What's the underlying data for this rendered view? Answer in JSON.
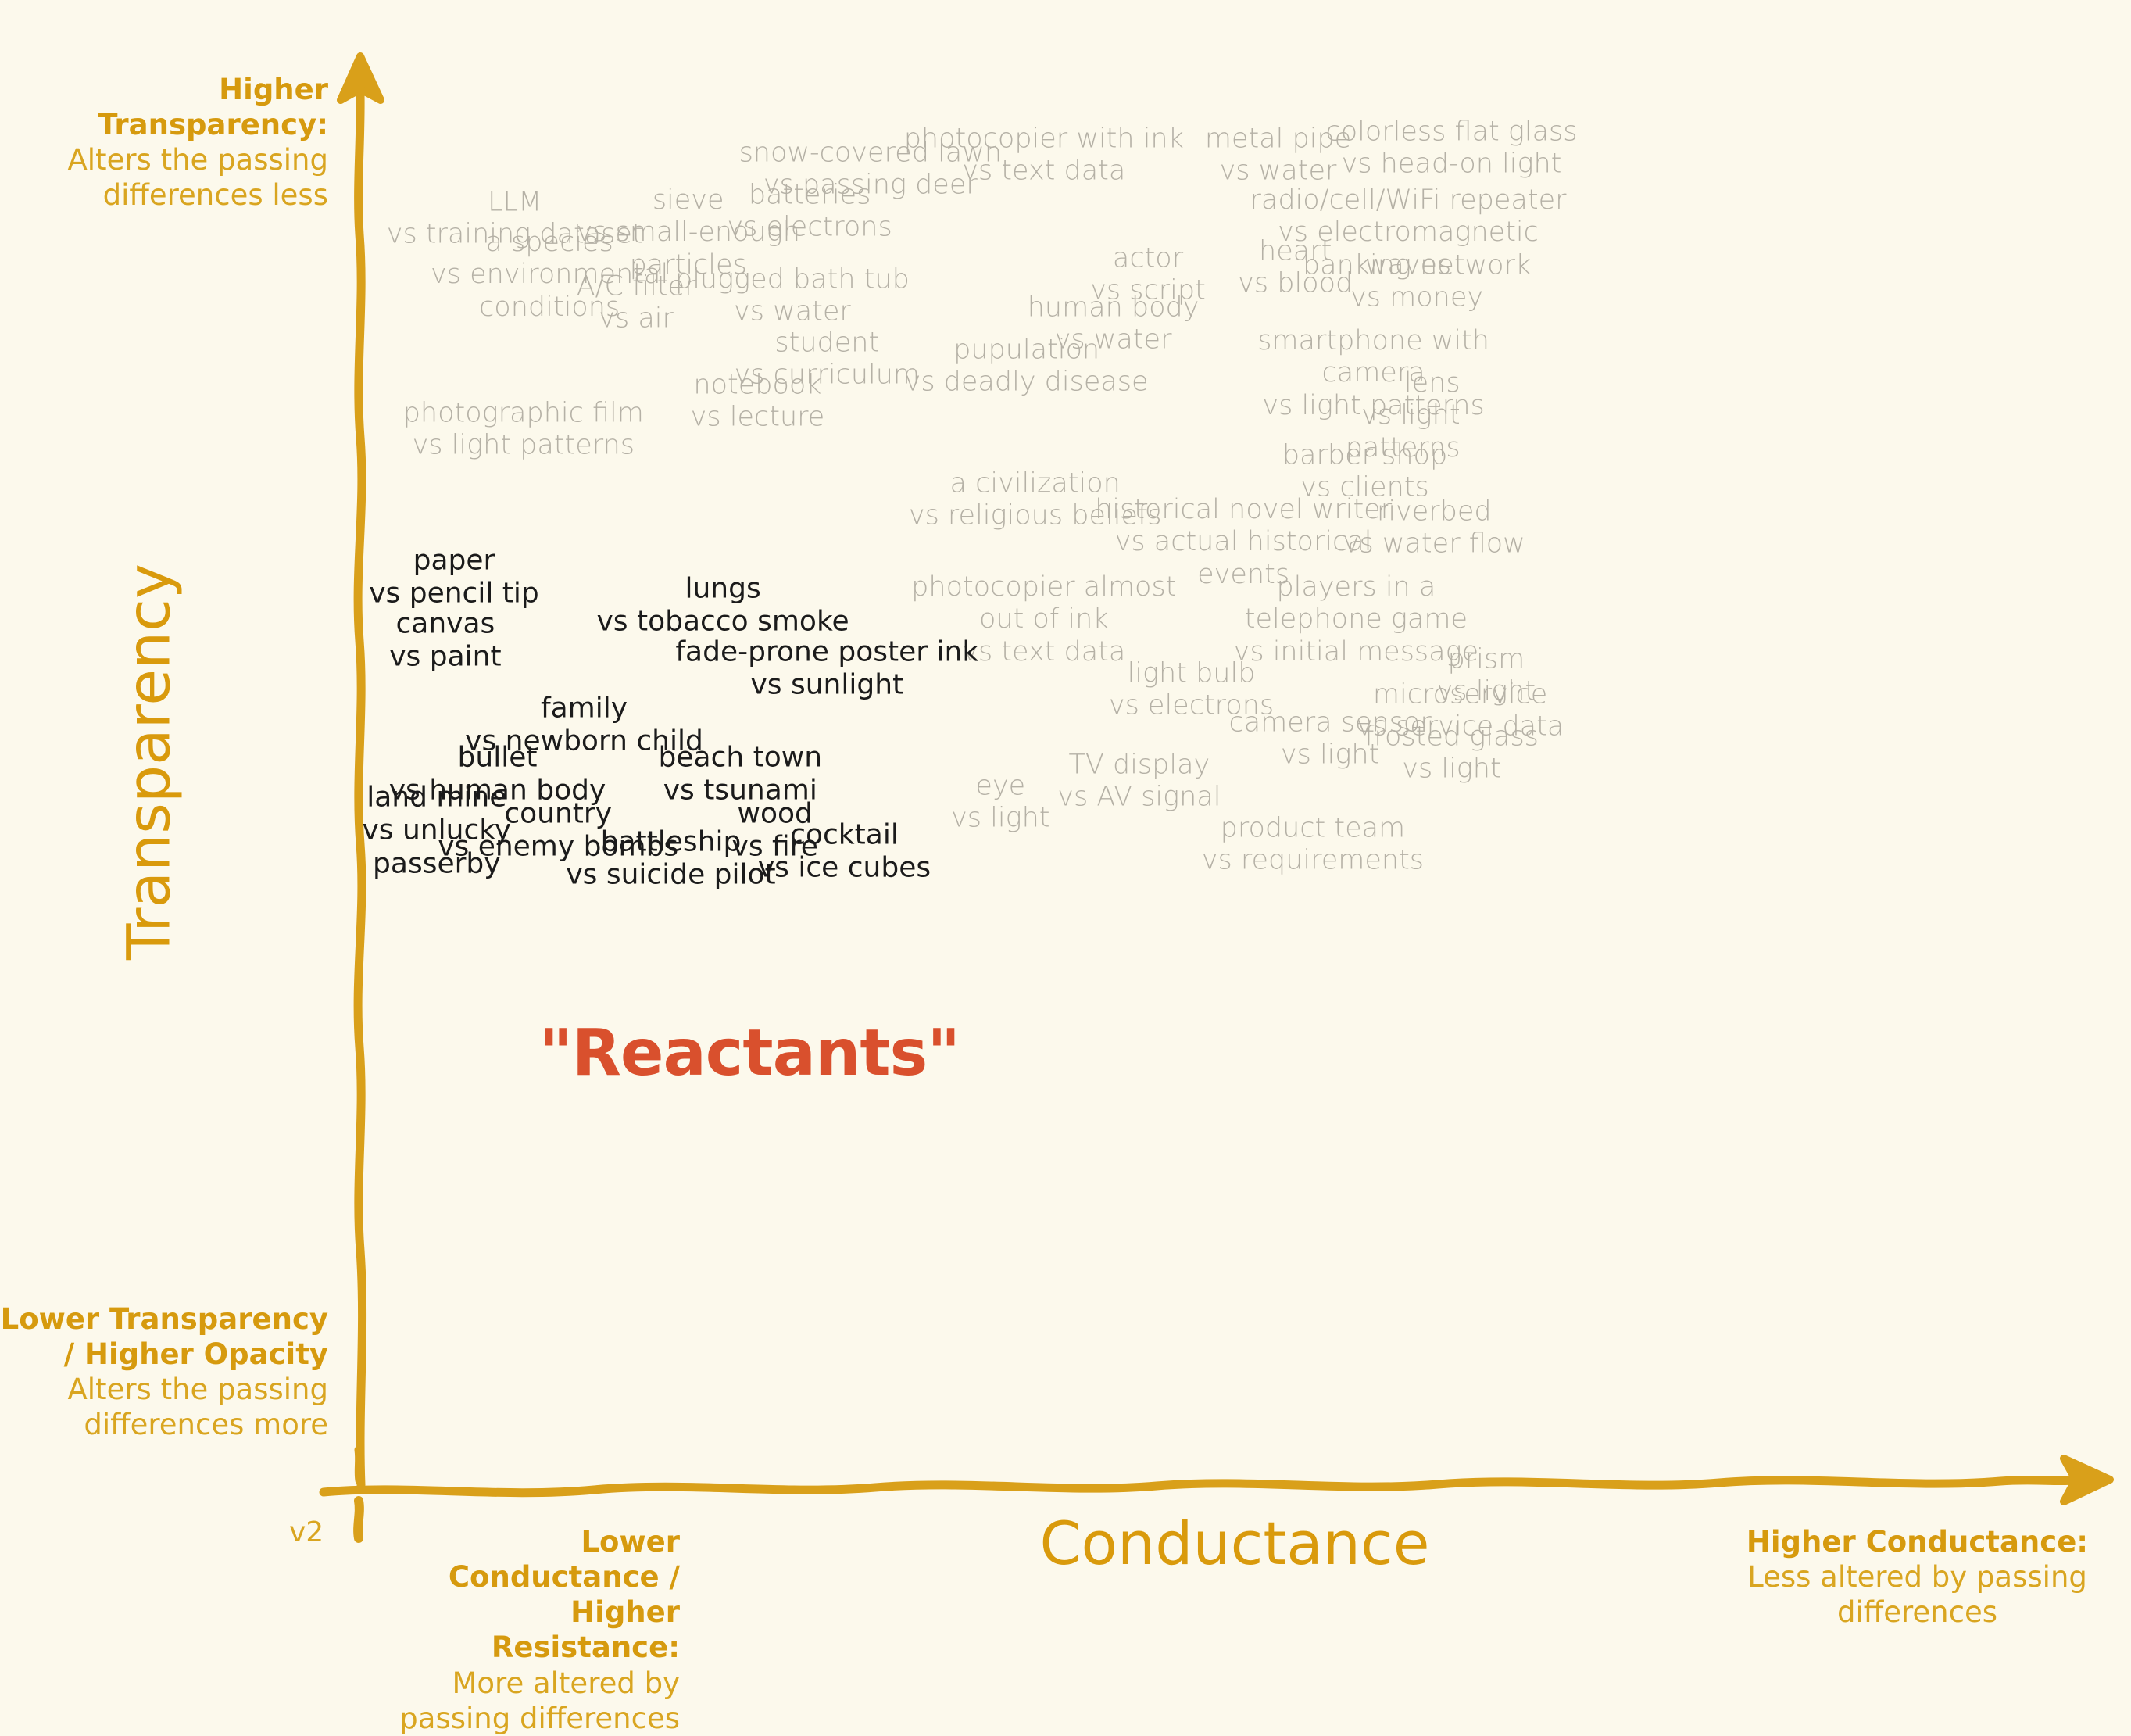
{
  "meta": {
    "version_label": "v2",
    "background_color": "#fcf9ec",
    "accent_gold": "#D9A01A",
    "accent_red": "#D9502D",
    "light_label_color": "#b5b1a6",
    "dark_label_color": "#1b1b1b"
  },
  "axes": {
    "y_title": "Transparency",
    "x_title": "Conductance",
    "y_top": {
      "bold": "Higher Transparency:",
      "normal": "Alters the passing\ndifferences less"
    },
    "y_bottom": {
      "bold": "Lower Transparency\n/ Higher Opacity",
      "normal": "Alters the passing\ndifferences more"
    },
    "x_left": {
      "bold": "Lower Conductance\n/ Higher Resistance:",
      "normal": "More altered by\npassing differences"
    },
    "x_right": {
      "bold": "Higher Conductance:",
      "normal": "Less altered by passing\ndifferences"
    }
  },
  "center_annotation": "\"Reactants\"",
  "chart_data": {
    "type": "scatter",
    "title": "",
    "xlabel": "Conductance",
    "ylabel": "Transparency",
    "xlim": [
      0,
      100
    ],
    "ylim": [
      0,
      100
    ],
    "grid": false,
    "legend": null,
    "note": "Text-label scatter. x = conductance (left low, right high), y = transparency (bottom low, top high). Values estimated from pixel position. 'tone' light = faint gray label, dark = black label.",
    "points": [
      {
        "label": "snow-covered lawn\nvs passing deer",
        "x": 29.0,
        "y": 93.5,
        "tone": "light",
        "align": "center"
      },
      {
        "label": "photocopier with ink\nvs text data",
        "x": 39.0,
        "y": 94.5,
        "tone": "light",
        "align": "center"
      },
      {
        "label": "metal pipe\nvs water",
        "x": 52.5,
        "y": 94.5,
        "tone": "light",
        "align": "center"
      },
      {
        "label": "colorless flat glass\nvs head-on light",
        "x": 62.5,
        "y": 95.0,
        "tone": "light",
        "align": "center"
      },
      {
        "label": "LLM\nvs training dataset",
        "x": 8.5,
        "y": 90.0,
        "tone": "light",
        "align": "center"
      },
      {
        "label": "sieve\nvs small-enough\nparticles",
        "x": 18.5,
        "y": 89.0,
        "tone": "light",
        "align": "center"
      },
      {
        "label": "batteries\nvs electrons",
        "x": 25.5,
        "y": 90.5,
        "tone": "light",
        "align": "center"
      },
      {
        "label": "radio/cell/WiFi repeater\nvs electromagnetic\nwaves",
        "x": 60.0,
        "y": 89.0,
        "tone": "light",
        "align": "center"
      },
      {
        "label": "a species\nvs environmental\nconditions",
        "x": 10.5,
        "y": 86.0,
        "tone": "light",
        "align": "center"
      },
      {
        "label": "A/C filter\nvs air",
        "x": 15.5,
        "y": 84.0,
        "tone": "light",
        "align": "center"
      },
      {
        "label": "plugged bath tub\nvs water",
        "x": 24.5,
        "y": 84.5,
        "tone": "light",
        "align": "center"
      },
      {
        "label": "actor\nvs script",
        "x": 45.0,
        "y": 86.0,
        "tone": "light",
        "align": "center"
      },
      {
        "label": "heart\nvs blood",
        "x": 53.5,
        "y": 86.5,
        "tone": "light",
        "align": "center"
      },
      {
        "label": "banking network\nvs money",
        "x": 60.5,
        "y": 85.5,
        "tone": "light",
        "align": "center"
      },
      {
        "label": "human body\nvs water",
        "x": 43.0,
        "y": 82.5,
        "tone": "light",
        "align": "center"
      },
      {
        "label": "student\nvs curriculum",
        "x": 26.5,
        "y": 80.0,
        "tone": "light",
        "align": "center"
      },
      {
        "label": "pupulation\nvs deadly disease",
        "x": 38.0,
        "y": 79.5,
        "tone": "light",
        "align": "center"
      },
      {
        "label": "smartphone with\ncamera\nvs light patterns",
        "x": 58.0,
        "y": 79.0,
        "tone": "light",
        "align": "center"
      },
      {
        "label": "notebook\nvs lecture",
        "x": 22.5,
        "y": 77.0,
        "tone": "light",
        "align": "center"
      },
      {
        "label": "lens\nvs light\npatterns",
        "x": 63.0,
        "y": 76.0,
        "tone": "right",
        "align": "right"
      },
      {
        "label": "photographic film\nvs light patterns",
        "x": 9.0,
        "y": 75.0,
        "tone": "light",
        "align": "center"
      },
      {
        "label": "barber shop\nvs clients",
        "x": 57.5,
        "y": 72.0,
        "tone": "light",
        "align": "center"
      },
      {
        "label": "a civilization\nvs religious beliefs",
        "x": 38.5,
        "y": 70.0,
        "tone": "light",
        "align": "center"
      },
      {
        "label": "riverbed\nvs water flow",
        "x": 61.5,
        "y": 68.0,
        "tone": "light",
        "align": "center"
      },
      {
        "label": "historical novel writer\nvs actual historical\nevents",
        "x": 50.5,
        "y": 67.0,
        "tone": "light",
        "align": "center"
      },
      {
        "label": "paper\nvs pencil tip",
        "x": 5.0,
        "y": 64.5,
        "tone": "dark",
        "align": "center"
      },
      {
        "label": "lungs\nvs tobacco smoke",
        "x": 20.5,
        "y": 62.5,
        "tone": "dark",
        "align": "center"
      },
      {
        "label": "photocopier almost\nout of ink\nvs text data",
        "x": 39.0,
        "y": 61.5,
        "tone": "light",
        "align": "center"
      },
      {
        "label": "players in a\ntelephone game\nvs initial message",
        "x": 57.0,
        "y": 61.5,
        "tone": "light",
        "align": "center"
      },
      {
        "label": "canvas\nvs paint",
        "x": 4.5,
        "y": 60.0,
        "tone": "dark",
        "align": "center"
      },
      {
        "label": "fade-prone poster ink\nvs sunlight",
        "x": 26.5,
        "y": 58.0,
        "tone": "dark",
        "align": "center"
      },
      {
        "label": "prism\nvs light",
        "x": 64.5,
        "y": 57.5,
        "tone": "light",
        "align": "center"
      },
      {
        "label": "light bulb\nvs electrons",
        "x": 47.5,
        "y": 56.5,
        "tone": "light",
        "align": "center"
      },
      {
        "label": "microservice\nvs service data",
        "x": 63.0,
        "y": 55.0,
        "tone": "light",
        "align": "center"
      },
      {
        "label": "family\nvs newborn child",
        "x": 12.5,
        "y": 54.0,
        "tone": "dark",
        "align": "center"
      },
      {
        "label": "camera sensor\nvs light",
        "x": 55.5,
        "y": 53.0,
        "tone": "light",
        "align": "center"
      },
      {
        "label": "frosted glass\nvs light",
        "x": 62.5,
        "y": 52.0,
        "tone": "light",
        "align": "center"
      },
      {
        "label": "bullet\nvs human body",
        "x": 7.5,
        "y": 50.5,
        "tone": "dark",
        "align": "center"
      },
      {
        "label": "beach town\nvs tsunami",
        "x": 21.5,
        "y": 50.5,
        "tone": "dark",
        "align": "center"
      },
      {
        "label": "TV display\nvs AV signal",
        "x": 44.5,
        "y": 50.0,
        "tone": "light",
        "align": "center"
      },
      {
        "label": "eye\nvs light",
        "x": 36.5,
        "y": 48.5,
        "tone": "light",
        "align": "center"
      },
      {
        "label": "land mine\nvs unlucky\npasserby",
        "x": 4.0,
        "y": 46.5,
        "tone": "dark",
        "align": "center"
      },
      {
        "label": "country\nvs enemy bombs",
        "x": 11.0,
        "y": 46.5,
        "tone": "dark",
        "align": "center"
      },
      {
        "label": "wood\nvs fire",
        "x": 23.5,
        "y": 46.5,
        "tone": "dark",
        "align": "center"
      },
      {
        "label": "cocktail\nvs ice cubes",
        "x": 27.5,
        "y": 45.0,
        "tone": "dark",
        "align": "center"
      },
      {
        "label": "battleship\nvs suicide pilot",
        "x": 17.5,
        "y": 44.5,
        "tone": "dark",
        "align": "center"
      },
      {
        "label": "product team\nvs requirements",
        "x": 54.5,
        "y": 45.5,
        "tone": "light",
        "align": "center"
      }
    ]
  },
  "labels": {
    "p01": "snow-covered lawn\nvs passing deer",
    "p02": "photocopier with ink\nvs text data",
    "p03": "metal pipe\nvs water",
    "p04": "colorless flat glass\nvs head-on light",
    "p05": "LLM\nvs training dataset",
    "p06": "sieve\nvs small-enough\nparticles",
    "p07": "batteries\nvs electrons",
    "p08": "radio/cell/WiFi repeater\nvs electromagnetic\nwaves",
    "p09": "a species\nvs environmental\nconditions",
    "p10": "A/C filter\nvs air",
    "p11": "plugged bath tub\nvs water",
    "p12": "actor\nvs script",
    "p13": "heart\nvs blood",
    "p14": "banking network\nvs money",
    "p15": "human body\nvs water",
    "p16": "student\nvs curriculum",
    "p17": "pupulation\nvs deadly disease",
    "p18": "smartphone with\ncamera\nvs light patterns",
    "p19": "notebook\nvs lecture",
    "p20": "lens\nvs light\npatterns",
    "p21": "photographic film\nvs light patterns",
    "p22": "barber shop\nvs clients",
    "p23": "a civilization\nvs religious beliefs",
    "p24": "riverbed\nvs water flow",
    "p25": "historical novel writer\nvs actual historical\nevents",
    "p26": "paper\nvs pencil tip",
    "p27": "lungs\nvs tobacco smoke",
    "p28": "photocopier almost\nout of ink\nvs text data",
    "p29": "players in a\ntelephone game\nvs initial message",
    "p30": "canvas\nvs paint",
    "p31": "fade-prone poster ink\nvs sunlight",
    "p32": "prism\nvs light",
    "p33": "light bulb\nvs electrons",
    "p34": "microservice\nvs service data",
    "p35": "family\nvs newborn child",
    "p36": "camera sensor\nvs light",
    "p37": "frosted glass\nvs light",
    "p38": "bullet\nvs human body",
    "p39": "beach town\nvs tsunami",
    "p40": "TV display\nvs AV signal",
    "p41": "eye\nvs light",
    "p42": "land mine\nvs unlucky\npasserby",
    "p43": "country\nvs enemy bombs",
    "p44": "wood\nvs fire",
    "p45": "cocktail\nvs ice cubes",
    "p46": "battleship\nvs suicide pilot",
    "p47": "product team\nvs requirements"
  }
}
